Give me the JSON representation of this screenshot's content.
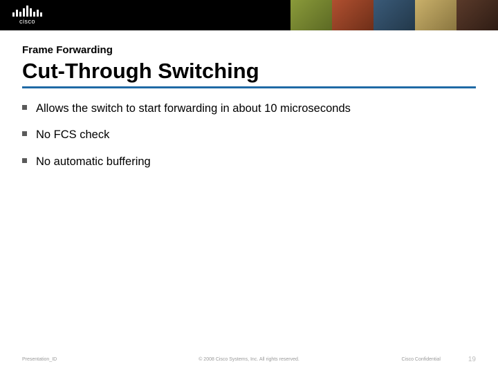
{
  "brand": {
    "name": "cisco"
  },
  "slide": {
    "kicker": "Frame Forwarding",
    "title": "Cut-Through Switching",
    "bullets": [
      "Allows the switch to start forwarding in about 10 microseconds",
      "No FCS check",
      "No automatic buffering"
    ]
  },
  "footer": {
    "presentation_id": "Presentation_ID",
    "copyright": "© 2008 Cisco Systems, Inc. All rights reserved.",
    "confidential": "Cisco Confidential",
    "page": "19"
  }
}
